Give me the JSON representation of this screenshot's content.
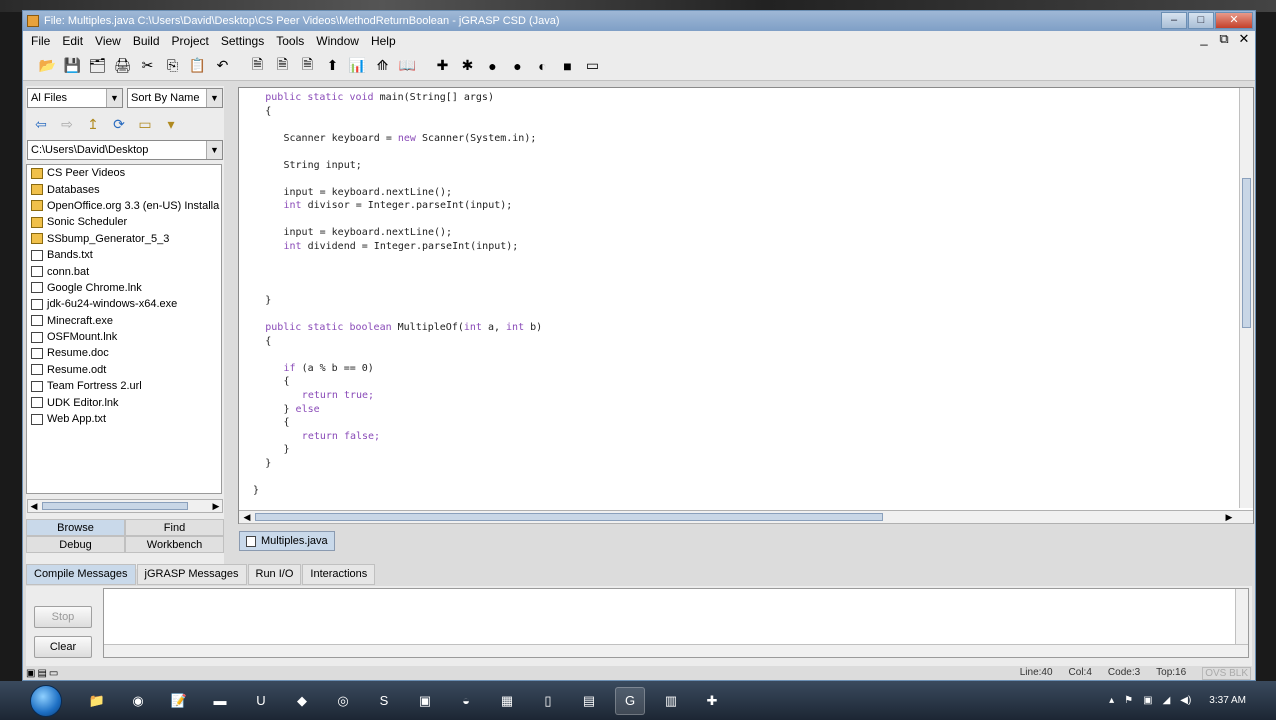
{
  "window": {
    "title": "File: Multiples.java  C:\\Users\\David\\Desktop\\CS Peer Videos\\MethodReturnBoolean - jGRASP CSD (Java)",
    "controls": [
      "–",
      "□",
      "✕"
    ]
  },
  "menu": {
    "items": [
      "File",
      "Edit",
      "View",
      "Build",
      "Project",
      "Settings",
      "Tools",
      "Window",
      "Help"
    ],
    "mdi_controls": [
      "_",
      "⧉",
      "✕"
    ]
  },
  "toolbar": {
    "icons": [
      "open-folder-icon",
      "save-icon",
      "save-all-icon",
      "print-icon",
      "cut-icon",
      "copy-icon",
      "paste-icon",
      "undo-icon",
      "sep",
      "file-icon",
      "file-icon-2",
      "file-icon-3",
      "arrow-icon",
      "chart-icon",
      "tree-icon",
      "book-icon",
      "sep",
      "compile-icon",
      "run-icon",
      "debug-icon",
      "step-icon",
      "bug-icon",
      "stop-icon",
      "window-icon"
    ],
    "glyphs": [
      "📂",
      "💾",
      "🗂",
      "🖨",
      "✂",
      "⎘",
      "📋",
      "↶",
      "",
      "🗎",
      "🗎",
      "🗎",
      "⬆",
      "📊",
      "⟰",
      "📖",
      "",
      "✚",
      "✱",
      "●",
      "●",
      "◐",
      "■",
      "▭"
    ]
  },
  "browser": {
    "filter": "Al Files",
    "sort": "Sort By Name",
    "path": "C:\\Users\\David\\Desktop",
    "nav_glyphs": [
      "⇦",
      "⇨",
      "↥",
      "⟳",
      "▭",
      "▾"
    ],
    "files": [
      {
        "name": "CS Peer Videos",
        "folder": true
      },
      {
        "name": "Databases",
        "folder": true
      },
      {
        "name": "OpenOffice.org 3.3 (en-US) Installa",
        "folder": true
      },
      {
        "name": "Sonic Scheduler",
        "folder": true
      },
      {
        "name": "SSbump_Generator_5_3",
        "folder": true
      },
      {
        "name": "Bands.txt",
        "folder": false
      },
      {
        "name": "conn.bat",
        "folder": false
      },
      {
        "name": "Google Chrome.lnk",
        "folder": false
      },
      {
        "name": "jdk-6u24-windows-x64.exe",
        "folder": false
      },
      {
        "name": "Minecraft.exe",
        "folder": false
      },
      {
        "name": "OSFMount.lnk",
        "folder": false
      },
      {
        "name": "Resume.doc",
        "folder": false
      },
      {
        "name": "Resume.odt",
        "folder": false
      },
      {
        "name": "Team Fortress 2.url",
        "folder": false
      },
      {
        "name": "UDK Editor.lnk",
        "folder": false
      },
      {
        "name": "Web App.txt",
        "folder": false
      }
    ],
    "tabs_top": [
      "Browse",
      "Find"
    ],
    "tabs_bottom": [
      "Debug",
      "Workbench"
    ]
  },
  "editor": {
    "lines": [
      {
        "indent": 2,
        "segs": [
          [
            "public static void ",
            "kw"
          ],
          [
            "main(String[] args)",
            ""
          ]
        ]
      },
      {
        "indent": 2,
        "segs": [
          [
            "{",
            ""
          ]
        ]
      },
      {
        "indent": 0,
        "segs": []
      },
      {
        "indent": 5,
        "segs": [
          [
            "Scanner keyboard = ",
            ""
          ],
          [
            "new",
            "kw"
          ],
          [
            " Scanner(System.in);",
            ""
          ]
        ]
      },
      {
        "indent": 0,
        "segs": []
      },
      {
        "indent": 5,
        "segs": [
          [
            "String input;",
            ""
          ]
        ]
      },
      {
        "indent": 0,
        "segs": []
      },
      {
        "indent": 5,
        "segs": [
          [
            "input = keyboard.nextLine();",
            ""
          ]
        ]
      },
      {
        "indent": 5,
        "segs": [
          [
            "int",
            "kw"
          ],
          [
            " divisor = Integer.parseInt(input);",
            ""
          ]
        ]
      },
      {
        "indent": 0,
        "segs": []
      },
      {
        "indent": 5,
        "segs": [
          [
            "input = keyboard.nextLine();",
            ""
          ]
        ]
      },
      {
        "indent": 5,
        "segs": [
          [
            "int",
            "kw"
          ],
          [
            " dividend = Integer.parseInt(input);",
            ""
          ]
        ]
      },
      {
        "indent": 0,
        "segs": []
      },
      {
        "indent": 0,
        "segs": []
      },
      {
        "indent": 0,
        "segs": []
      },
      {
        "indent": 2,
        "segs": [
          [
            "}",
            ""
          ]
        ]
      },
      {
        "indent": 0,
        "segs": []
      },
      {
        "indent": 2,
        "segs": [
          [
            "public static boolean ",
            "kw"
          ],
          [
            "MultipleOf(",
            ""
          ],
          [
            "int",
            "kw"
          ],
          [
            " a, ",
            ""
          ],
          [
            "int",
            "kw"
          ],
          [
            " b)",
            ""
          ]
        ]
      },
      {
        "indent": 2,
        "segs": [
          [
            "{",
            ""
          ]
        ]
      },
      {
        "indent": 0,
        "segs": []
      },
      {
        "indent": 5,
        "segs": [
          [
            "if",
            "kw"
          ],
          [
            " (a % b == 0)",
            ""
          ]
        ]
      },
      {
        "indent": 5,
        "segs": [
          [
            "{",
            ""
          ]
        ]
      },
      {
        "indent": 8,
        "segs": [
          [
            "return true;",
            "kw"
          ]
        ]
      },
      {
        "indent": 5,
        "segs": [
          [
            "} ",
            ""
          ],
          [
            "else",
            "kw"
          ]
        ]
      },
      {
        "indent": 5,
        "segs": [
          [
            "{",
            ""
          ]
        ]
      },
      {
        "indent": 8,
        "segs": [
          [
            "return false;",
            "kw"
          ]
        ]
      },
      {
        "indent": 5,
        "segs": [
          [
            "}",
            ""
          ]
        ]
      },
      {
        "indent": 2,
        "segs": [
          [
            "}",
            ""
          ]
        ]
      },
      {
        "indent": 0,
        "segs": []
      },
      {
        "indent": 0,
        "segs": [
          [
            "}",
            ""
          ]
        ]
      }
    ]
  },
  "doc_tab": "Multiples.java",
  "messages": {
    "tabs": [
      "Compile Messages",
      "jGRASP Messages",
      "Run I/O",
      "Interactions"
    ],
    "stop": "Stop",
    "clear": "Clear"
  },
  "status": {
    "line": "Line:40",
    "col": "Col:4",
    "code": "Code:3",
    "top": "Top:16",
    "mode": "OVS BLK"
  },
  "taskbar": {
    "apps": [
      "📁",
      "◉",
      "📝",
      "▬",
      "U",
      "◆",
      "◎",
      "S",
      "▣",
      "◒",
      "▦",
      "▯",
      "▤",
      "G",
      "▥",
      "✚"
    ],
    "open": [
      13
    ],
    "time": "3:37 AM",
    "tray_icons": [
      "▴",
      "⚑",
      "▣",
      "◢",
      "◀)"
    ]
  },
  "colors": {
    "keyword": "#8a4bb8",
    "title_bar": "#8aa7cc",
    "active_tab": "#c9d9ea"
  }
}
